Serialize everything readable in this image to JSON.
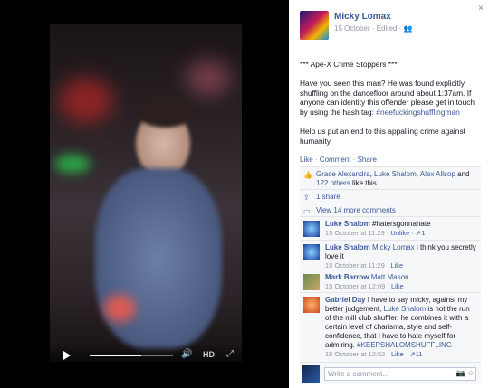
{
  "video": {
    "hd_label": "HD",
    "progress": 0.62,
    "icons": {
      "play": "play-icon",
      "volume": "volume-icon",
      "expand": "expand-icon"
    }
  },
  "post": {
    "close_icon": "×",
    "author": "Micky Lomax",
    "meta": "15 October · Edited · ",
    "title": "*** Ape-X Crime Stoppers ***",
    "body": "Have you seen this man? He was found explicitly shuffling on the dancefloor around about 1:37am. If anyone can identity this offender please get in touch by using the hash tag: ",
    "hashtag": "#neefuckingshufflingman",
    "closing": "Help us put an end to this appalling crime against humanity.",
    "actions": {
      "like": "Like",
      "comment": "Comment",
      "share": "Share",
      "sep": " · "
    }
  },
  "likes": {
    "name1": "Grace Alexandra",
    "name2": "Luke Shalom",
    "name3": "Alex Allsop",
    "and": " and ",
    "others": "122 others",
    "suffix": " like this."
  },
  "shares": {
    "label": "1 share"
  },
  "more_comments": {
    "label": "View 14 more comments"
  },
  "comments": [
    {
      "name": "Luke Shalom",
      "text": " #hatersgonnahate",
      "time": "15 October at 11:29 · ",
      "action": "Unlike",
      "likes": " · ⇗1"
    },
    {
      "name": "Luke Shalom",
      "tag": "Micky Lomax",
      "text": " i think you secretly love it",
      "time": "15 October at 11:29 · ",
      "action": "Like"
    },
    {
      "name": "Mark Barrow",
      "tag": "Matt Mason",
      "time": "15 October at 12:09 · ",
      "action": "Like"
    },
    {
      "name": "Gabriel Day",
      "text1": " I have to say micky, against my better judgement, ",
      "tag": "Luke Shalom",
      "text2": " is not the run of the mill club shuffler, he combines it with a certain level of charisma, style and self-confidence, that I have to hate myself for admiring. ",
      "hashtag": "#KEEPSHALOMSHUFFLING",
      "time": "15 October at 12:52 · ",
      "action": "Like",
      "likes": " · ⇗11"
    }
  ],
  "write": {
    "placeholder": "Write a comment..."
  }
}
